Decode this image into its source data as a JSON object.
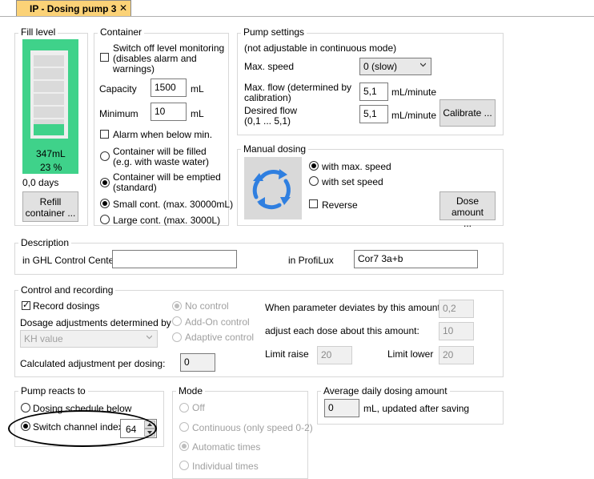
{
  "tab": {
    "title": "IP - Dosing pump 3",
    "close": "✕"
  },
  "fill_level": {
    "title": "Fill level",
    "amount": "347mL",
    "percent": "23 %",
    "days": "0,0 days",
    "percent_value": 0.23,
    "refill_btn_line1": "Refill",
    "refill_btn_line2": "container ..."
  },
  "container": {
    "title": "Container",
    "switch_off_line1": "Switch off level monitoring",
    "switch_off_line2": "(disables alarm and",
    "switch_off_line3": "warnings)",
    "capacity_label": "Capacity",
    "capacity_value": "1500",
    "capacity_unit": "mL",
    "minimum_label": "Minimum",
    "minimum_value": "10",
    "minimum_unit": "mL",
    "alarm_label": "Alarm when below min.",
    "filled_line1": "Container will be filled",
    "filled_line2": "(e.g. with waste water)",
    "emptied_line1": "Container will be emptied",
    "emptied_line2": "(standard)",
    "small_label": "Small cont. (max. 30000mL)",
    "large_label": "Large cont. (max. 3000L)"
  },
  "pump_settings": {
    "title": "Pump settings",
    "note": "(not adjustable in continuous mode)",
    "max_speed_label": "Max. speed",
    "max_speed_value": "0 (slow)",
    "max_flow_line1": "Max. flow (determined by",
    "max_flow_line2": "calibration)",
    "max_flow_value": "5,1",
    "max_flow_unit": "mL/minute",
    "desired_line1": "Desired flow",
    "desired_line2": "(0,1 ... 5,1)",
    "desired_value": "5,1",
    "desired_unit": "mL/minute",
    "calibrate_btn": "Calibrate ..."
  },
  "manual_dosing": {
    "title": "Manual dosing",
    "max_speed_label": "with max. speed",
    "set_speed_label": "with set speed",
    "reverse_label": "Reverse",
    "dose_btn_line1": "Dose amount",
    "dose_btn_line2": "..."
  },
  "description": {
    "title": "Description",
    "ghl_label": "in GHL Control Center",
    "ghl_value": "",
    "profilux_label": "in ProfiLux",
    "profilux_value": "Cor7 3a+b"
  },
  "control": {
    "title": "Control and recording",
    "record_label": "Record dosings",
    "dosage_label": "Dosage adjustments determined by",
    "dosage_value": "KH value",
    "calc_label": "Calculated adjustment per dosing:",
    "calc_value": "0",
    "no_control": "No control",
    "addon_control": "Add-On control",
    "adaptive_control": "Adaptive control",
    "deviates_label": "When parameter deviates by this amount",
    "deviates_value": "0,2",
    "adjust_label": "adjust each dose about this amount:",
    "adjust_value": "10",
    "limit_raise_label": "Limit raise",
    "limit_raise_value": "20",
    "limit_lower_label": "Limit lower",
    "limit_lower_value": "20"
  },
  "pump_reacts": {
    "title": "Pump reacts to",
    "schedule_label": "Dosing schedule below",
    "switch_label": "Switch channel index",
    "switch_value": "64"
  },
  "mode": {
    "title": "Mode",
    "off": "Off",
    "continuous": "Continuous (only speed 0-2)",
    "automatic": "Automatic times",
    "individual": "Individual times"
  },
  "average": {
    "title": "Average daily dosing amount",
    "value": "0",
    "unit": "mL, updated after saving"
  },
  "colors": {
    "tab_bg": "#fbd277",
    "tank_green": "#3fd28a",
    "dose_icon_blue": "#2f7fe0"
  }
}
